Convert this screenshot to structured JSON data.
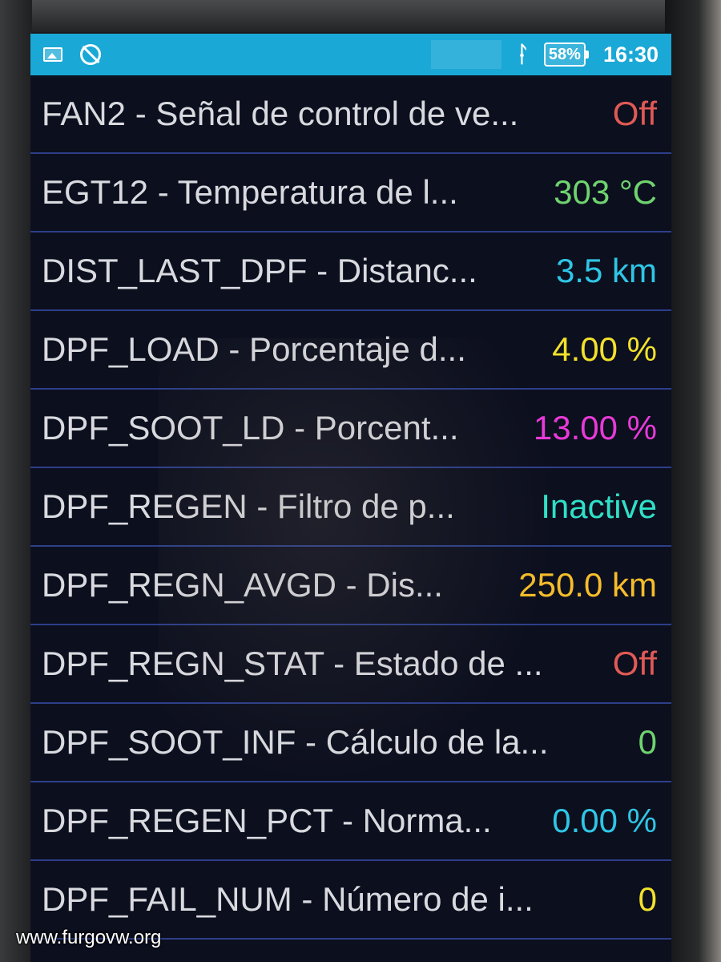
{
  "status_bar": {
    "icons": [
      "photo-icon",
      "no-sync-icon",
      "bluetooth-icon",
      "battery-icon"
    ],
    "battery_percent": "58%",
    "time": "16:30",
    "color": "#1aa8d6"
  },
  "list": {
    "border_color": "#2d3f8a",
    "rows": [
      {
        "label": "FAN2 - Señal de control de ve...",
        "value": "Off",
        "color": "#e05a55"
      },
      {
        "label": "EGT12 - Temperatura de l...",
        "value": "303 °C",
        "color": "#6fd36f"
      },
      {
        "label": "DIST_LAST_DPF - Distanc...",
        "value": "3.5 km",
        "color": "#2fc6e6"
      },
      {
        "label": "DPF_LOAD - Porcentaje d...",
        "value": "4.00 %",
        "color": "#f3e12b"
      },
      {
        "label": "DPF_SOOT_LD - Porcent...",
        "value": "13.00 %",
        "color": "#e83ad8"
      },
      {
        "label": "DPF_REGEN - Filtro de p...",
        "value": "Inactive",
        "color": "#2fe0c8"
      },
      {
        "label": "DPF_REGN_AVGD - Dis...",
        "value": "250.0 km",
        "color": "#f6bd2a"
      },
      {
        "label": "DPF_REGN_STAT - Estado de ...",
        "value": "Off",
        "color": "#e05a55"
      },
      {
        "label": "DPF_SOOT_INF - Cálculo de la...",
        "value": "0",
        "color": "#6fd36f"
      },
      {
        "label": "DPF_REGEN_PCT - Norma...",
        "value": "0.00 %",
        "color": "#2fc6e6"
      },
      {
        "label": "DPF_FAIL_NUM - Número de i...",
        "value": "0",
        "color": "#f3e12b"
      }
    ]
  },
  "watermark": "www.furgovw.org"
}
